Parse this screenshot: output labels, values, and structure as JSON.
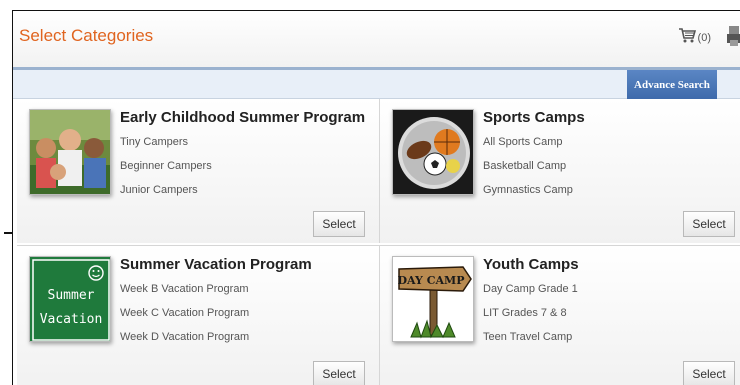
{
  "header": {
    "title": "Select Categories",
    "cart_count": "(0)"
  },
  "toolbar": {
    "advance_search_label": "Advance Search"
  },
  "categories": [
    {
      "title": "Early Childhood Summer Program",
      "items": [
        "Tiny Campers",
        "Beginner Campers",
        "Junior Campers"
      ],
      "button": "Select",
      "image": "children-photo"
    },
    {
      "title": "Sports Camps",
      "items": [
        "All Sports Camp",
        "Basketball Camp",
        "Gymnastics Camp"
      ],
      "button": "Select",
      "image": "sports-balls-photo"
    },
    {
      "title": "Summer Vacation Program",
      "items": [
        "Week B Vacation Program",
        "Week C Vacation Program",
        "Week D Vacation Program"
      ],
      "button": "Select",
      "image": "summer-vacation-sign",
      "image_text": [
        "Summer",
        "Vacation"
      ]
    },
    {
      "title": "Youth Camps",
      "items": [
        "Day Camp Grade 1",
        "LIT Grades 7 & 8",
        "Teen Travel Camp"
      ],
      "button": "Select",
      "image": "day-camp-sign",
      "image_text": "DAY CAMP"
    }
  ],
  "colors": {
    "title": "#e0641f",
    "advance_search_bg": "#4a76b8",
    "subbar": "#e8eff8",
    "summer_sign": "#1f7a3c"
  }
}
